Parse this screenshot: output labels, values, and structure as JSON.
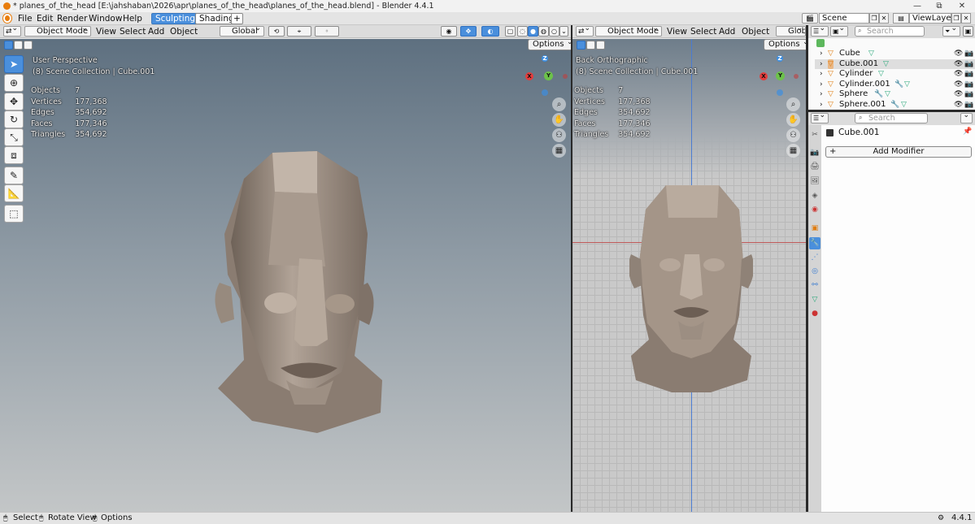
{
  "window": {
    "title": "* planes_of_the_head [E:\\jahshaban\\2026\\apr\\planes_of_the_head\\planes_of_the_head.blend] - Blender 4.4.1",
    "minimize": "—",
    "maximize": "⧉",
    "close": "✕"
  },
  "menubar": {
    "items": [
      "File",
      "Edit",
      "Render",
      "Window",
      "Help"
    ],
    "workspaces": [
      "Sculpting",
      "Shading"
    ],
    "add_workspace": "+",
    "scene_name": "Scene",
    "view_layer": "ViewLayer"
  },
  "viewport_left": {
    "mode": "Object Mode",
    "menus": [
      "View",
      "Select",
      "Add",
      "Object"
    ],
    "orientation": "Global",
    "options": "Options",
    "view_name": "User Perspective",
    "collection": "(8) Scene Collection | Cube.001",
    "stats": [
      {
        "label": "Objects",
        "value": "7"
      },
      {
        "label": "Vertices",
        "value": "177,368"
      },
      {
        "label": "Edges",
        "value": "354,692"
      },
      {
        "label": "Faces",
        "value": "177,346"
      },
      {
        "label": "Triangles",
        "value": "354,692"
      }
    ],
    "gizmo": {
      "x": "X",
      "y": "Y",
      "z": "Z"
    }
  },
  "viewport_right": {
    "mode": "Object Mode",
    "menus": [
      "View",
      "Select",
      "Add",
      "Object"
    ],
    "orientation": "Glob",
    "options": "Options",
    "view_name": "Back Orthographic",
    "collection": "(8) Scene Collection | Cube.001",
    "stats": [
      {
        "label": "Objects",
        "value": "7"
      },
      {
        "label": "Vertices",
        "value": "177,368"
      },
      {
        "label": "Edges",
        "value": "354,692"
      },
      {
        "label": "Faces",
        "value": "177,346"
      },
      {
        "label": "Triangles",
        "value": "354,692"
      }
    ],
    "gizmo": {
      "x": "X",
      "y": "Y",
      "z": "Z"
    }
  },
  "outliner": {
    "search_placeholder": "Search",
    "items": [
      {
        "name": "Cube",
        "mods": ""
      },
      {
        "name": "Cube.001",
        "mods": ""
      },
      {
        "name": "Cylinder",
        "mods": ""
      },
      {
        "name": "Cylinder.001",
        "mods": "wrench"
      },
      {
        "name": "Sphere",
        "mods": "wrench"
      },
      {
        "name": "Sphere.001",
        "mods": "wrench"
      }
    ]
  },
  "properties": {
    "search_placeholder": "Search",
    "object_name": "Cube.001",
    "add_modifier": "Add Modifier",
    "add_modifier_icon": "+"
  },
  "statusbar": {
    "select": "Select",
    "rotate": "Rotate View",
    "options": "Options",
    "version": "4.4.1"
  },
  "colors": {
    "accent": "#4a8fdc",
    "viewport_top": "#5d6e80",
    "viewport_bottom": "#c6c8c8",
    "ortho_bg": "#c7c7c7",
    "head": "#8f8176",
    "x_axis": "#e43c3c",
    "y_axis": "#6cc24a",
    "z_axis": "#3d8ee0"
  }
}
